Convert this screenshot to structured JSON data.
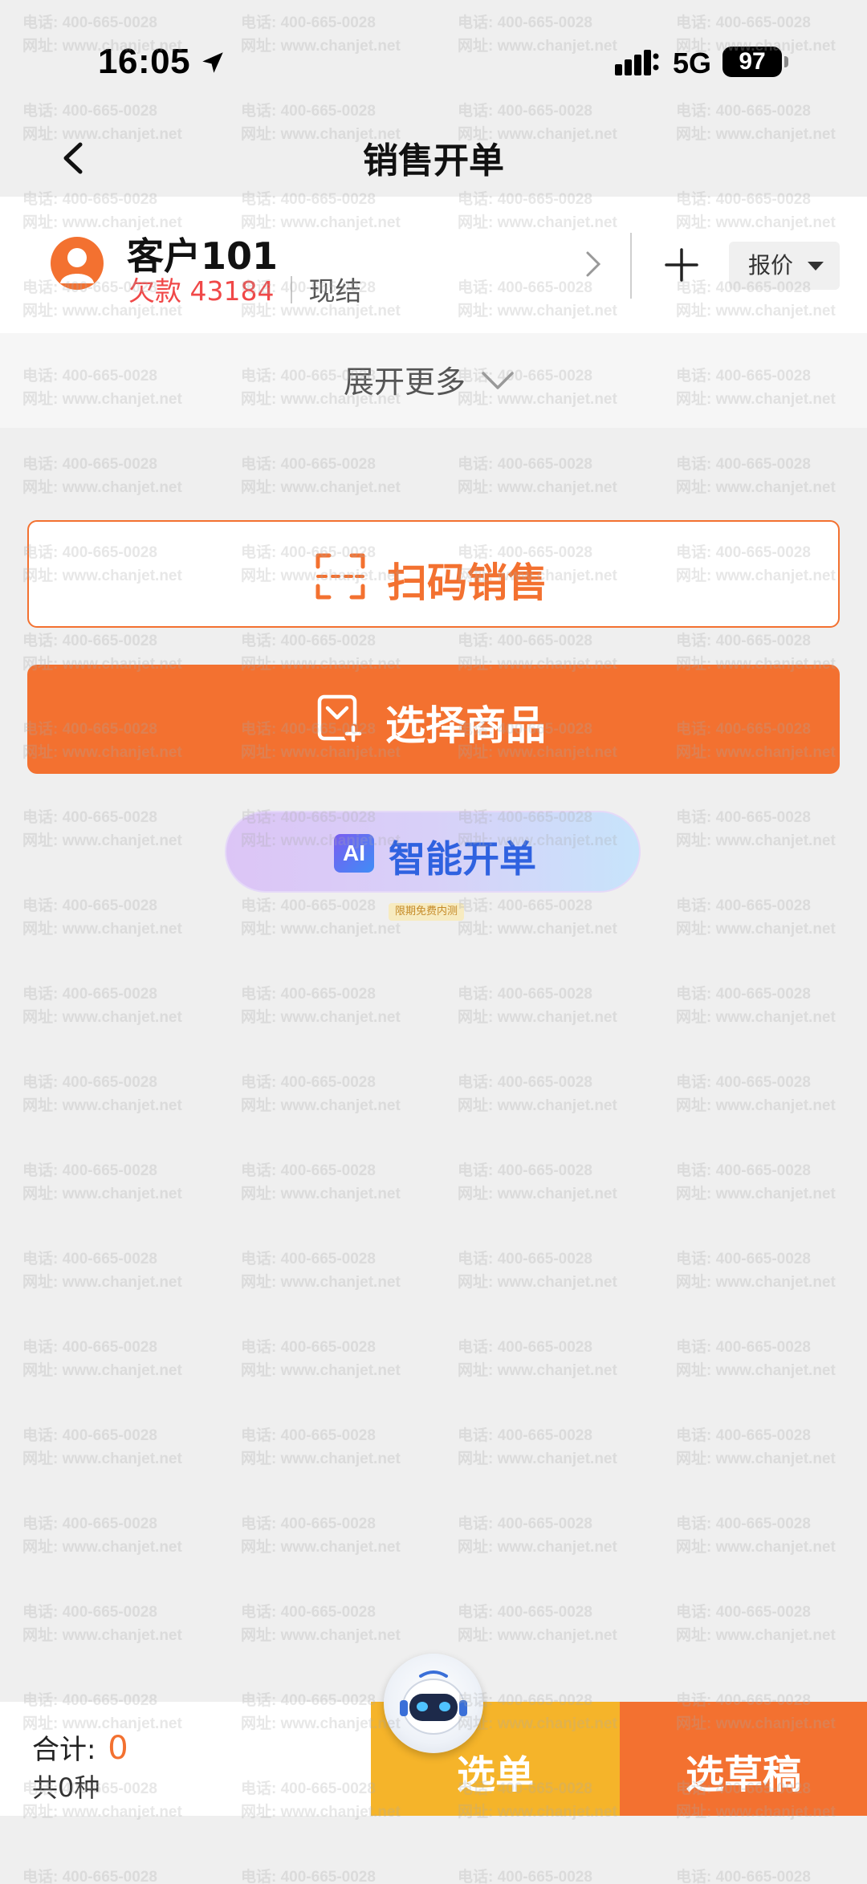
{
  "status_bar": {
    "time": "16:05",
    "network": "5G",
    "battery": "97"
  },
  "nav": {
    "title": "销售开单"
  },
  "customer": {
    "name": "客户101",
    "debt_label": "欠款",
    "debt_value": "43184",
    "settle_type": "现结",
    "price_type": "报价"
  },
  "expand": {
    "label": "展开更多"
  },
  "actions": {
    "scan_label": "扫码销售",
    "select_goods_label": "选择商品",
    "ai_badge": "AI",
    "ai_label": "智能开单",
    "ai_tag": "限期免费内测"
  },
  "footer": {
    "total_label": "合计:",
    "total_value": "0",
    "count_text": "共0种",
    "select_order_label": "选单",
    "draft_label": "选草稿"
  },
  "watermark": {
    "phone": "电话: 400-665-0028",
    "site": "网址: www.chanjet.net"
  },
  "colors": {
    "accent": "#f37130",
    "debt": "#f04848",
    "select_order": "#f5b42a",
    "ai_text": "#2f62e0"
  },
  "icons": {
    "back": "chevron-left-icon",
    "location": "location-arrow-icon",
    "signal": "signal-bars-icon",
    "avatar": "user-avatar-icon",
    "chevron": "chevron-right-icon",
    "add": "plus-icon",
    "caret": "caret-down-icon",
    "expand": "chevron-down-icon",
    "scan": "scan-frame-icon",
    "select": "product-add-icon",
    "robot": "robot-assistant-icon"
  }
}
